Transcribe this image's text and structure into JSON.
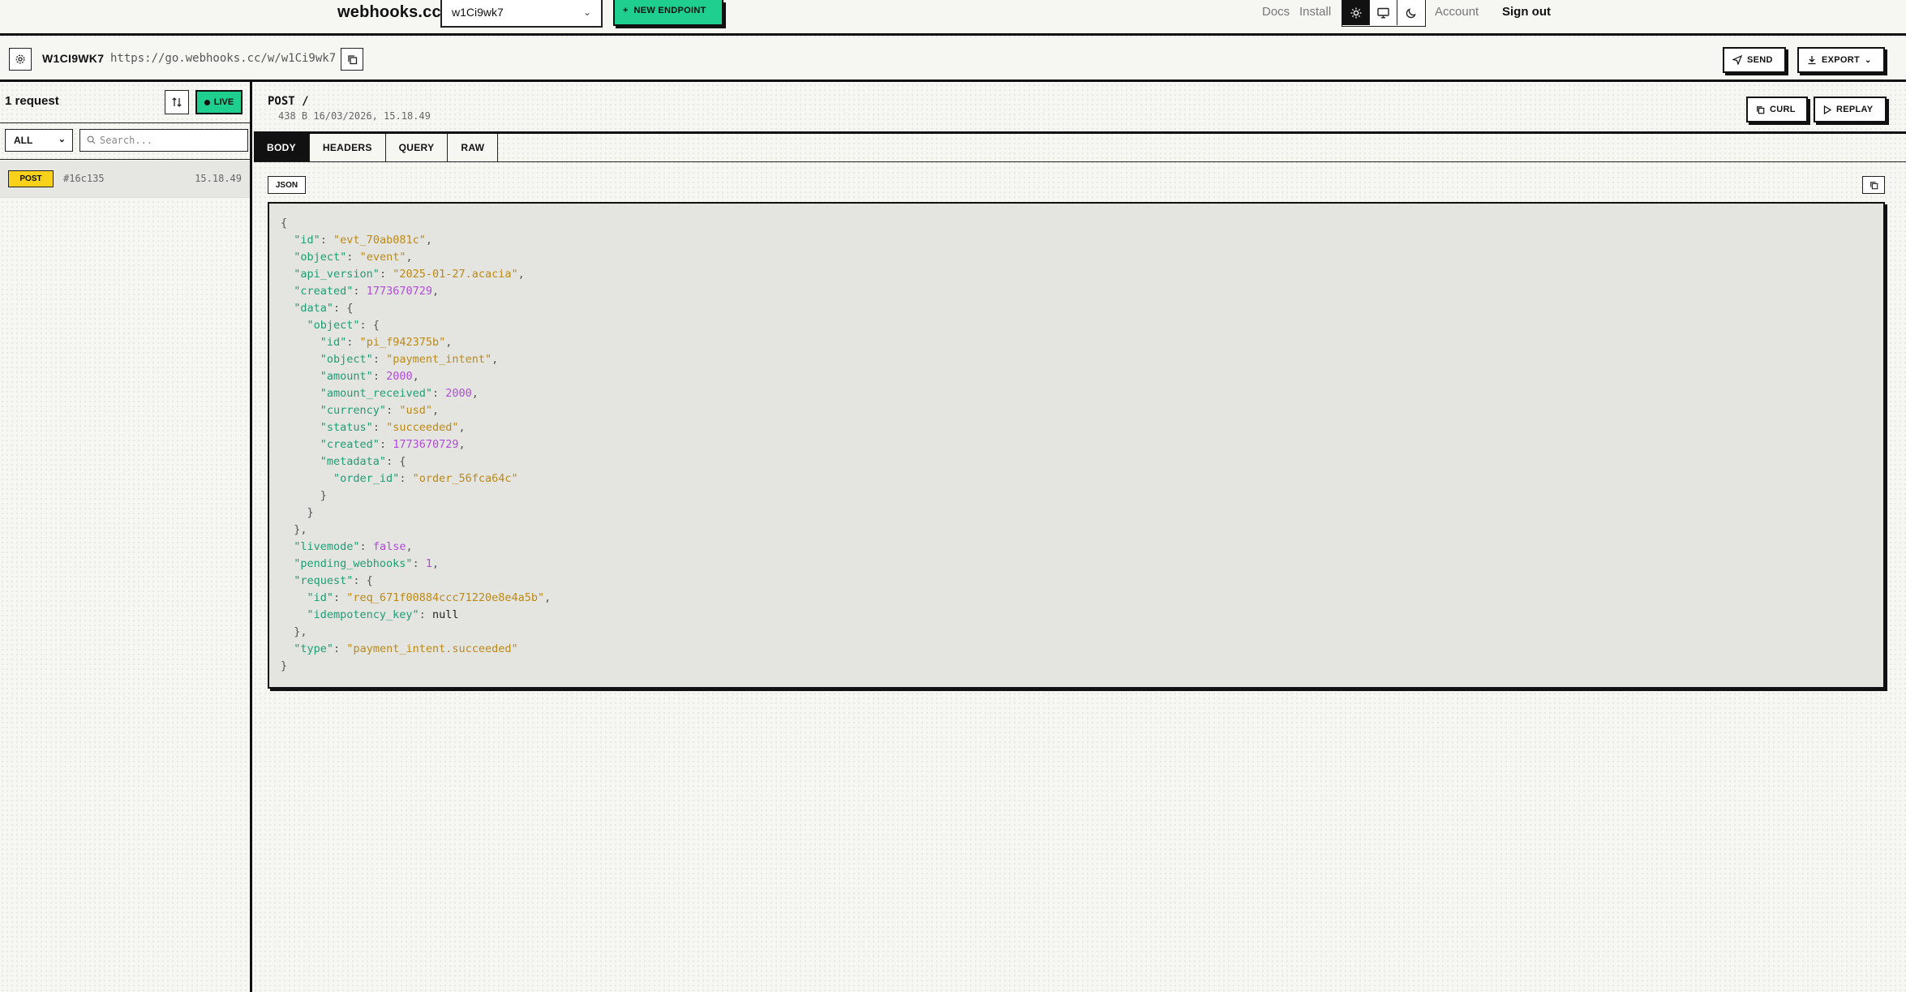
{
  "topnav": {
    "brand": "webhooks.cc",
    "endpoint_select": "w1Ci9wk7",
    "new_endpoint_label": "NEW ENDPOINT",
    "docs": "Docs",
    "install": "Install",
    "account": "Account",
    "sign_out": "Sign out",
    "theme_options": [
      "light",
      "system",
      "dark"
    ],
    "theme_active": "light"
  },
  "endpoint_bar": {
    "name": "W1CI9WK7",
    "url": "https://go.webhooks.cc/w/w1Ci9wk7",
    "send_label": "SEND",
    "export_label": "EXPORT"
  },
  "sidebar": {
    "request_count": "1 request",
    "live_label": "LIVE",
    "filter_value": "ALL",
    "search_placeholder": "Search...",
    "requests": [
      {
        "method": "POST",
        "id": "#16c135",
        "time": "15.18.49"
      }
    ]
  },
  "request": {
    "title": "POST /",
    "meta": "438 B  16/03/2026, 15.18.49",
    "curl_label": "CURL",
    "replay_label": "REPLAY",
    "tabs": [
      "BODY",
      "HEADERS",
      "QUERY",
      "RAW"
    ],
    "active_tab": "BODY",
    "format_tag": "JSON"
  },
  "colors": {
    "accent_green": "#1fcf8f",
    "badge_yellow": "#f8d11b",
    "json_key": "#1e9e75",
    "json_string": "#bb8a18",
    "json_number": "#b04cd8"
  },
  "body_lines": [
    [
      [
        "p",
        "{"
      ]
    ],
    [
      [
        "p",
        "  "
      ],
      [
        "k",
        "\"id\""
      ],
      [
        "p",
        ": "
      ],
      [
        "s",
        "\"evt_70ab081c\""
      ],
      [
        "p",
        ","
      ]
    ],
    [
      [
        "p",
        "  "
      ],
      [
        "k",
        "\"object\""
      ],
      [
        "p",
        ": "
      ],
      [
        "s",
        "\"event\""
      ],
      [
        "p",
        ","
      ]
    ],
    [
      [
        "p",
        "  "
      ],
      [
        "k",
        "\"api_version\""
      ],
      [
        "p",
        ": "
      ],
      [
        "s",
        "\"2025-01-27.acacia\""
      ],
      [
        "p",
        ","
      ]
    ],
    [
      [
        "p",
        "  "
      ],
      [
        "k",
        "\"created\""
      ],
      [
        "p",
        ": "
      ],
      [
        "n",
        "1773670729"
      ],
      [
        "p",
        ","
      ]
    ],
    [
      [
        "p",
        "  "
      ],
      [
        "k",
        "\"data\""
      ],
      [
        "p",
        ": {"
      ]
    ],
    [
      [
        "p",
        "    "
      ],
      [
        "k",
        "\"object\""
      ],
      [
        "p",
        ": {"
      ]
    ],
    [
      [
        "p",
        "      "
      ],
      [
        "k",
        "\"id\""
      ],
      [
        "p",
        ": "
      ],
      [
        "s",
        "\"pi_f942375b\""
      ],
      [
        "p",
        ","
      ]
    ],
    [
      [
        "p",
        "      "
      ],
      [
        "k",
        "\"object\""
      ],
      [
        "p",
        ": "
      ],
      [
        "s",
        "\"payment_intent\""
      ],
      [
        "p",
        ","
      ]
    ],
    [
      [
        "p",
        "      "
      ],
      [
        "k",
        "\"amount\""
      ],
      [
        "p",
        ": "
      ],
      [
        "n",
        "2000"
      ],
      [
        "p",
        ","
      ]
    ],
    [
      [
        "p",
        "      "
      ],
      [
        "k",
        "\"amount_received\""
      ],
      [
        "p",
        ": "
      ],
      [
        "n",
        "2000"
      ],
      [
        "p",
        ","
      ]
    ],
    [
      [
        "p",
        "      "
      ],
      [
        "k",
        "\"currency\""
      ],
      [
        "p",
        ": "
      ],
      [
        "s",
        "\"usd\""
      ],
      [
        "p",
        ","
      ]
    ],
    [
      [
        "p",
        "      "
      ],
      [
        "k",
        "\"status\""
      ],
      [
        "p",
        ": "
      ],
      [
        "s",
        "\"succeeded\""
      ],
      [
        "p",
        ","
      ]
    ],
    [
      [
        "p",
        "      "
      ],
      [
        "k",
        "\"created\""
      ],
      [
        "p",
        ": "
      ],
      [
        "n",
        "1773670729"
      ],
      [
        "p",
        ","
      ]
    ],
    [
      [
        "p",
        "      "
      ],
      [
        "k",
        "\"metadata\""
      ],
      [
        "p",
        ": {"
      ]
    ],
    [
      [
        "p",
        "        "
      ],
      [
        "k",
        "\"order_id\""
      ],
      [
        "p",
        ": "
      ],
      [
        "s",
        "\"order_56fca64c\""
      ]
    ],
    [
      [
        "p",
        "      }"
      ]
    ],
    [
      [
        "p",
        "    }"
      ]
    ],
    [
      [
        "p",
        "  },"
      ]
    ],
    [
      [
        "p",
        "  "
      ],
      [
        "k",
        "\"livemode\""
      ],
      [
        "p",
        ": "
      ],
      [
        "n",
        "false"
      ],
      [
        "p",
        ","
      ]
    ],
    [
      [
        "p",
        "  "
      ],
      [
        "k",
        "\"pending_webhooks\""
      ],
      [
        "p",
        ": "
      ],
      [
        "n",
        "1"
      ],
      [
        "p",
        ","
      ]
    ],
    [
      [
        "p",
        "  "
      ],
      [
        "k",
        "\"request\""
      ],
      [
        "p",
        ": {"
      ]
    ],
    [
      [
        "p",
        "    "
      ],
      [
        "k",
        "\"id\""
      ],
      [
        "p",
        ": "
      ],
      [
        "s",
        "\"req_671f00884ccc71220e8e4a5b\""
      ],
      [
        "p",
        ","
      ]
    ],
    [
      [
        "p",
        "    "
      ],
      [
        "k",
        "\"idempotency_key\""
      ],
      [
        "p",
        ": "
      ],
      [
        "nl",
        "null"
      ]
    ],
    [
      [
        "p",
        "  },"
      ]
    ],
    [
      [
        "p",
        "  "
      ],
      [
        "k",
        "\"type\""
      ],
      [
        "p",
        ": "
      ],
      [
        "s",
        "\"payment_intent.succeeded\""
      ]
    ],
    [
      [
        "p",
        "}"
      ]
    ]
  ]
}
